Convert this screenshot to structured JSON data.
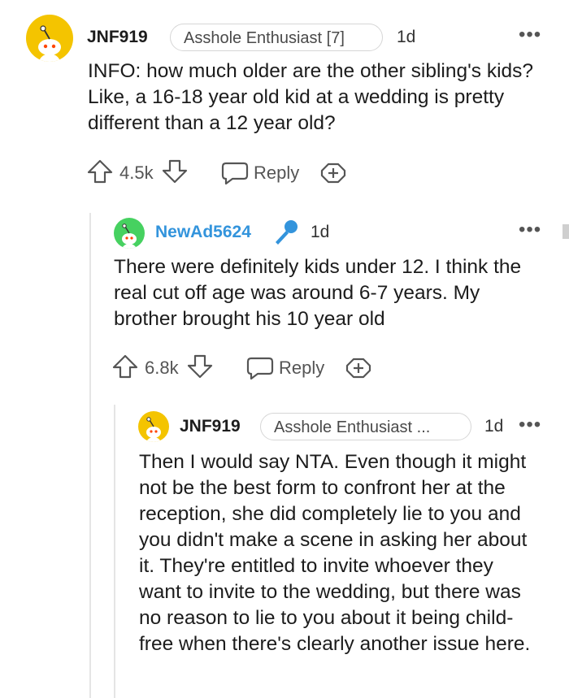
{
  "comments": [
    {
      "username": "JNF919",
      "flair": "Asshole Enthusiast [7]",
      "time": "1d",
      "body": "INFO: how much older are the other sibling's kids? Like, a 16-18 year old kid at a wedding is pretty different than a 12 year old?",
      "score": "4.5k",
      "reply_label": "Reply",
      "more_label": "•••",
      "avatar_color": "#f4c400"
    },
    {
      "username": "NewAd5624",
      "flair": "",
      "time": "1d",
      "body": "There were definitely kids under 12. I think the real cut off age was around 6-7 years. My brother brought his 10 year old",
      "score": "6.8k",
      "reply_label": "Reply",
      "more_label": "•••",
      "avatar_color": "#46d160",
      "username_color": "#3394dc",
      "op_icon": "microphone-icon"
    },
    {
      "username": "JNF919",
      "flair": "Asshole Enthusiast ...",
      "time": "1d",
      "body": "Then I would say NTA. Even though it might not be the best form to confront her at the reception, she did completely lie to you and you didn't make a scene in asking her about it. They're entitled to invite whoever they want to invite to the wedding, but there was no reason to lie to you about it being child-free when there's clearly another issue here.",
      "more_label": "•••",
      "avatar_color": "#f4c400"
    }
  ]
}
